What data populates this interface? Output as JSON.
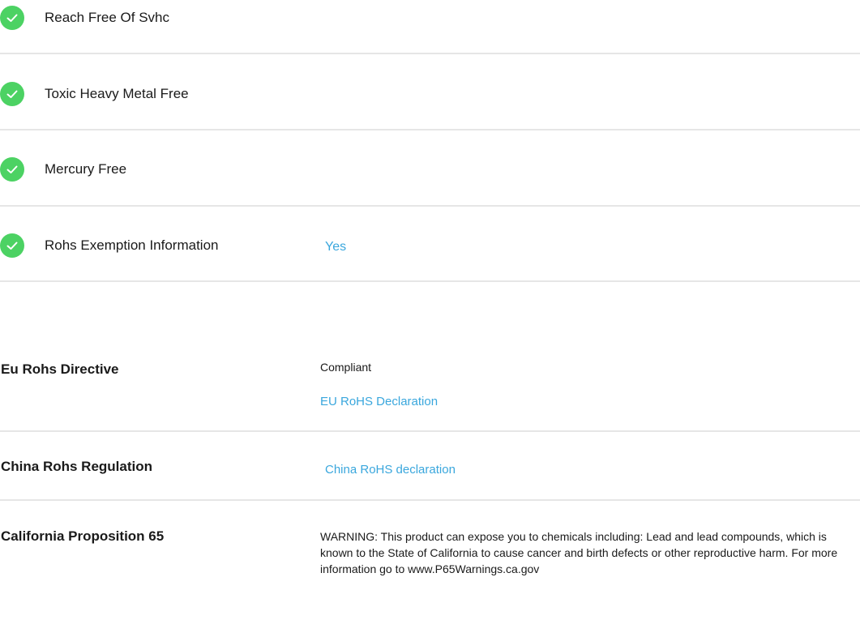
{
  "checks": [
    {
      "label": "Reach Free Of Svhc",
      "value": ""
    },
    {
      "label": "Toxic Heavy Metal Free",
      "value": ""
    },
    {
      "label": "Mercury Free",
      "value": ""
    },
    {
      "label": "Rohs Exemption Information",
      "value": "Yes"
    }
  ],
  "regulations": {
    "eu": {
      "label": "Eu Rohs Directive",
      "status": "Compliant",
      "link": "EU RoHS Declaration"
    },
    "china": {
      "label": "China Rohs Regulation",
      "link": "China RoHS declaration"
    },
    "california": {
      "label": "California Proposition 65",
      "warning": "WARNING: This product can expose you to chemicals including: Lead and lead compounds, which is known to the State of California to cause cancer and birth defects or other reproductive harm. For more information go to www.P65Warnings.ca.gov"
    }
  },
  "colors": {
    "check_green": "#4cd263",
    "link_blue": "#3aa7dd",
    "divider": "#e6e6e6"
  }
}
